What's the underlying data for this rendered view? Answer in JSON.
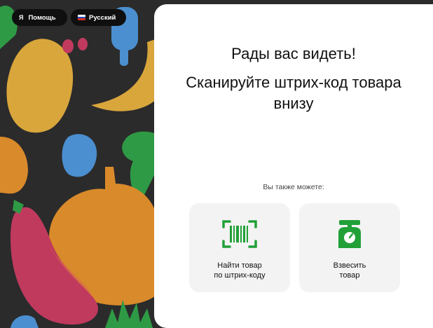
{
  "topbar": {
    "help_icon": "yandex-icon",
    "help_label": "Помощь",
    "language_icon": "russian-flag-icon",
    "language_label": "Русский"
  },
  "main": {
    "greeting": "Рады вас видеть!",
    "instruction": "Сканируйте штрих-код товара внизу",
    "also_label": "Вы также можете:",
    "actions": [
      {
        "icon": "barcode-scan-icon",
        "label_line1": "Найти товар",
        "label_line2": "по штрих-коду"
      },
      {
        "icon": "scale-icon",
        "label_line1": "Взвесить",
        "label_line2": "товар"
      }
    ]
  },
  "colors": {
    "accent": "#21a038",
    "panel": "#ffffff",
    "card": "#f3f3f3",
    "background": "#2b2b2b"
  }
}
